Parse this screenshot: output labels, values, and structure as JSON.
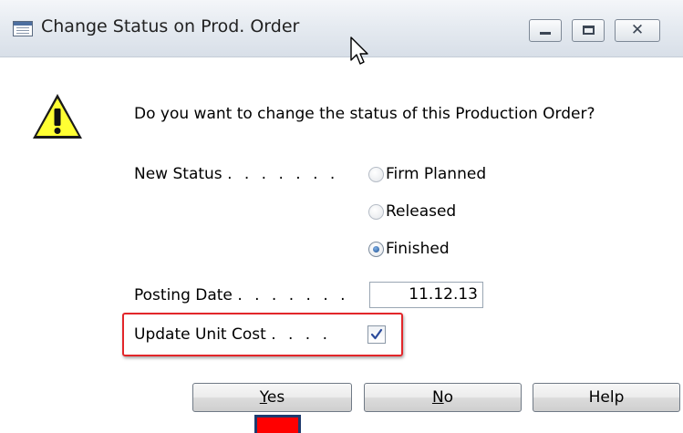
{
  "window": {
    "title": "Change Status on Prod. Order",
    "close_glyph": "✕",
    "icons": [
      "form-icon",
      "minimize-icon",
      "maximize-icon",
      "close-icon",
      "mouse-cursor-icon"
    ]
  },
  "dialog": {
    "icon": "warning-icon",
    "warning_glyph": "!",
    "question": "Do you want to change the status of this Production Order?",
    "new_status_label": "New Status",
    "new_status_dots": ". . . . . . .",
    "status_options": [
      {
        "label": "Firm Planned",
        "selected": false
      },
      {
        "label": "Released",
        "selected": false
      },
      {
        "label": "Finished",
        "selected": true
      }
    ],
    "posting_date_label": "Posting Date",
    "posting_date_dots": ". . . . . . .",
    "posting_date_value": "11.12.13",
    "update_unit_cost_label": "Update Unit Cost",
    "update_unit_cost_dots": ". . . .",
    "update_unit_cost_checked": true,
    "highlight_color": "#e2262a"
  },
  "buttons": {
    "yes_first": "Y",
    "yes_rest": "es",
    "no_first": "N",
    "no_rest": "o",
    "help": "Help"
  }
}
